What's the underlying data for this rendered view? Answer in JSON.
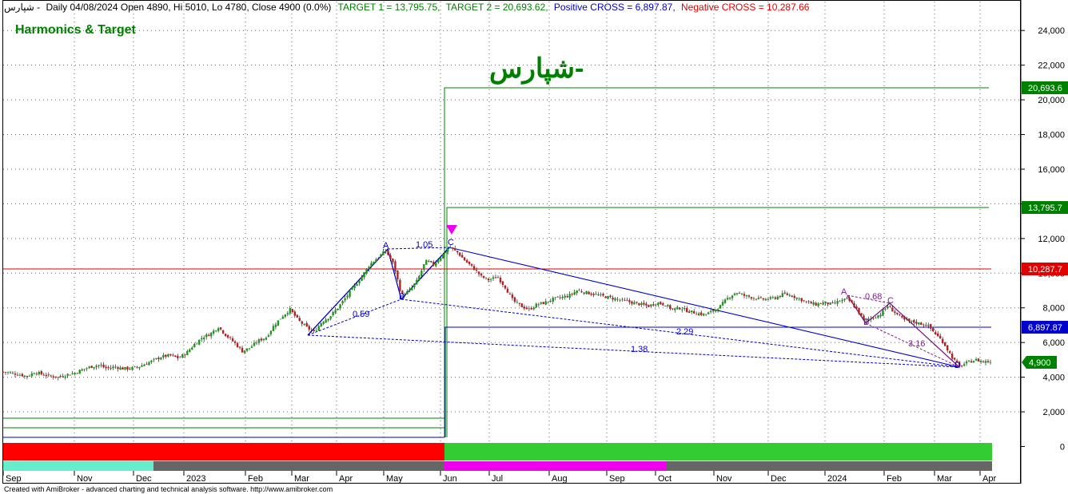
{
  "header": {
    "symbol": "شپارس -",
    "info": "Daily 04/08/2024 Open 4890, Hi 5010, Lo 4780, Close 4900 (0.0%)",
    "target1": "TARGET 1 = 13,795.75,",
    "target2": "TARGET 2 = 20,693.62,",
    "pos_cross": "Positive CROSS   = 6,897.87,",
    "neg_cross": "Negative CROSS   = 10,287.66"
  },
  "panel_title": "Harmonics & Target",
  "watermark": "شپارس-",
  "footer": "Created with AmiBroker - advanced charting and technical analysis software. http://www.amibroker.com",
  "colors": {
    "green": "#008000",
    "red": "#e00000",
    "blue": "#0000cc",
    "purple": "#7a1f8a",
    "magenta": "#ee00ee",
    "bar_red": "#ff0000",
    "bar_green": "#33cc33",
    "bar_cyan": "#66eecc",
    "bar_gray": "#666666"
  },
  "chart_data": {
    "type": "candlestick",
    "y_axis": {
      "min": 0,
      "max": 24000,
      "ticks": [
        "0",
        "2,000",
        "4,000",
        "6,000",
        "8,000",
        "10,000",
        "12,000",
        "14,000",
        "16,000",
        "18,000",
        "20,000",
        "22,000",
        "24,000"
      ]
    },
    "x_axis": {
      "ticks": [
        "Sep",
        "Nov",
        "Dec",
        "2023",
        "Feb",
        "Mar",
        "Apr",
        "May",
        "Jun",
        "Jul",
        "Aug",
        "Sep",
        "Oct",
        "Nov",
        "Dec",
        "2024",
        "Feb",
        "Mar",
        "Apr"
      ]
    },
    "levels": [
      {
        "name": "target2",
        "value": 20693.62,
        "label": "20,693.6",
        "color": "#008000"
      },
      {
        "name": "target1",
        "value": 13795.75,
        "label": "13,795.7",
        "color": "#008000"
      },
      {
        "name": "neg-cross",
        "value": 10287.66,
        "label": "10,287.7",
        "color": "#e00000"
      },
      {
        "name": "pos-cross",
        "value": 6897.87,
        "label": "6,897.87",
        "color": "#0000cc"
      },
      {
        "name": "last-close",
        "value": 4900,
        "label": "4,900",
        "color": "#008000"
      }
    ],
    "close_series": [
      [
        0,
        4300
      ],
      [
        10,
        4250
      ],
      [
        20,
        4150
      ],
      [
        30,
        4050
      ],
      [
        40,
        4300
      ],
      [
        50,
        4150
      ],
      [
        60,
        4050
      ],
      [
        70,
        4000
      ],
      [
        80,
        4150
      ],
      [
        90,
        4250
      ],
      [
        100,
        4450
      ],
      [
        110,
        4600
      ],
      [
        120,
        4700
      ],
      [
        130,
        4500
      ],
      [
        140,
        4600
      ],
      [
        150,
        4500
      ],
      [
        160,
        4500
      ],
      [
        170,
        4600
      ],
      [
        180,
        4800
      ],
      [
        190,
        5000
      ],
      [
        200,
        5200
      ],
      [
        210,
        5250
      ],
      [
        220,
        5100
      ],
      [
        230,
        5400
      ],
      [
        240,
        5900
      ],
      [
        250,
        6300
      ],
      [
        260,
        6500
      ],
      [
        270,
        6900
      ],
      [
        280,
        6400
      ],
      [
        290,
        6000
      ],
      [
        300,
        5500
      ],
      [
        310,
        5700
      ],
      [
        320,
        6100
      ],
      [
        330,
        6300
      ],
      [
        340,
        7000
      ],
      [
        350,
        7500
      ],
      [
        360,
        7900
      ],
      [
        370,
        7300
      ],
      [
        380,
        6900
      ],
      [
        390,
        6600
      ],
      [
        400,
        7200
      ],
      [
        410,
        7500
      ],
      [
        420,
        8000
      ],
      [
        430,
        8600
      ],
      [
        440,
        9200
      ],
      [
        450,
        9800
      ],
      [
        460,
        10500
      ],
      [
        470,
        10900
      ],
      [
        480,
        11300
      ],
      [
        490,
        10500
      ],
      [
        500,
        8700
      ],
      [
        510,
        9000
      ],
      [
        520,
        9600
      ],
      [
        530,
        10700
      ],
      [
        540,
        10500
      ],
      [
        550,
        11000
      ],
      [
        560,
        11500
      ],
      [
        570,
        11200
      ],
      [
        580,
        10700
      ],
      [
        590,
        10300
      ],
      [
        600,
        9800
      ],
      [
        610,
        9600
      ],
      [
        620,
        9800
      ],
      [
        630,
        9200
      ],
      [
        640,
        8400
      ],
      [
        650,
        8100
      ],
      [
        660,
        7900
      ],
      [
        670,
        8200
      ],
      [
        680,
        8300
      ],
      [
        690,
        8500
      ],
      [
        700,
        8600
      ],
      [
        710,
        8700
      ],
      [
        720,
        9000
      ],
      [
        730,
        8900
      ],
      [
        740,
        8800
      ],
      [
        750,
        8700
      ],
      [
        760,
        8600
      ],
      [
        770,
        8500
      ],
      [
        780,
        8400
      ],
      [
        790,
        8300
      ],
      [
        800,
        8200
      ],
      [
        810,
        8100
      ],
      [
        820,
        8300
      ],
      [
        830,
        8200
      ],
      [
        840,
        7900
      ],
      [
        850,
        8000
      ],
      [
        860,
        7800
      ],
      [
        870,
        7700
      ],
      [
        880,
        7600
      ],
      [
        890,
        7800
      ],
      [
        900,
        8100
      ],
      [
        910,
        8600
      ],
      [
        920,
        8900
      ],
      [
        930,
        8700
      ],
      [
        940,
        8600
      ],
      [
        950,
        8500
      ],
      [
        960,
        8500
      ],
      [
        970,
        8600
      ],
      [
        980,
        8800
      ],
      [
        990,
        8700
      ],
      [
        1000,
        8500
      ],
      [
        1010,
        8300
      ],
      [
        1020,
        8200
      ],
      [
        1030,
        8300
      ],
      [
        1040,
        8200
      ],
      [
        1050,
        8400
      ],
      [
        1060,
        8500
      ],
      [
        1070,
        8000
      ],
      [
        1080,
        7300
      ],
      [
        1090,
        7400
      ],
      [
        1100,
        7600
      ],
      [
        1110,
        8100
      ],
      [
        1120,
        7700
      ],
      [
        1130,
        7300
      ],
      [
        1140,
        7200
      ],
      [
        1150,
        7100
      ],
      [
        1160,
        7000
      ],
      [
        1170,
        6500
      ],
      [
        1180,
        6000
      ],
      [
        1190,
        5200
      ],
      [
        1200,
        4600
      ],
      [
        1210,
        4850
      ],
      [
        1220,
        5000
      ],
      [
        1230,
        4900
      ],
      [
        1240,
        4900
      ]
    ],
    "harmonic_labels": [
      "A",
      "B",
      "C",
      "A",
      "B",
      "C",
      "D",
      "1.05",
      "0.59",
      "2.29",
      "1.38",
      "0.68",
      "3.16"
    ]
  }
}
